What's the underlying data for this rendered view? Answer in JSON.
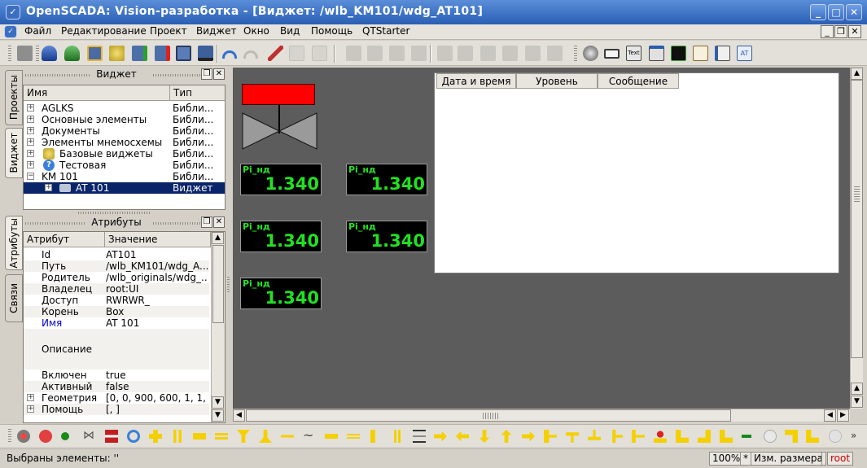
{
  "window": {
    "title": "OpenSCADA: Vision-разработка - [Виджет: /wlb_KM101/wdg_AT101]",
    "controls": [
      "_",
      "□",
      "✕"
    ]
  },
  "menu": {
    "items": [
      "Файл",
      "Редактирование",
      "Проект",
      "Виджет",
      "Окно",
      "Вид",
      "Помощь",
      "QTStarter"
    ]
  },
  "side_tabs": {
    "top": [
      "Проекты",
      "Виджет"
    ],
    "bottom": [
      "Атрибуты",
      "Связи"
    ]
  },
  "widget_dock": {
    "title": "Виджет",
    "columns": [
      "Имя",
      "Тип"
    ],
    "rows": [
      {
        "name": "AGLKS",
        "type": "Библи..."
      },
      {
        "name": "Основные элементы",
        "type": "Библи..."
      },
      {
        "name": "Документы",
        "type": "Библи..."
      },
      {
        "name": "Элементы мнемосхемы",
        "type": "Библи..."
      },
      {
        "name": "Базовые виджеты",
        "type": "Библи..."
      },
      {
        "name": "Тестовая",
        "type": "Библи..."
      },
      {
        "name": "KM 101",
        "type": "Библи..."
      },
      {
        "name": "AT 101",
        "type": "Виджет"
      }
    ]
  },
  "attr_dock": {
    "title": "Атрибуты",
    "columns": [
      "Атрибут",
      "Значение"
    ],
    "rows": [
      {
        "key": "Id",
        "value": "AT101"
      },
      {
        "key": "Путь",
        "value": "/wlb_KM101/wdg_A..."
      },
      {
        "key": "Родитель",
        "value": "/wlb_originals/wdg_..."
      },
      {
        "key": "Владелец",
        "value": "root:UI"
      },
      {
        "key": "Доступ",
        "value": "RWRWR_"
      },
      {
        "key": "Корень",
        "value": "Box"
      },
      {
        "key": "Имя",
        "value": "AT 101"
      },
      {
        "key": "Описание",
        "value": ""
      },
      {
        "key": "Включен",
        "value": "true"
      },
      {
        "key": "Активный",
        "value": "false"
      },
      {
        "key": "Геометрия",
        "value": "[0, 0, 900, 600, 1, 1, ..."
      },
      {
        "key": "Помощь",
        "value": "[, ]"
      }
    ]
  },
  "canvas": {
    "meters": [
      {
        "label": "Pi_нд",
        "value": "1.340"
      },
      {
        "label": "Pi_нд",
        "value": "1.340"
      },
      {
        "label": "Pi_нд",
        "value": "1.340"
      },
      {
        "label": "Pi_нд",
        "value": "1.340"
      },
      {
        "label": "Pi_нд",
        "value": "1.340"
      }
    ],
    "messages_table": {
      "columns": [
        "Дата и время",
        "Уровень",
        "Сообщение"
      ]
    },
    "colors": {
      "background": "#5c5c5c",
      "actuator": "#ff0000",
      "meter_text": "#22e022"
    }
  },
  "statusbar": {
    "selection": "Выбраны элементы: ''",
    "zoom": "100%",
    "modified": "*",
    "resize_mode": "Изм. размера",
    "user": "root"
  }
}
